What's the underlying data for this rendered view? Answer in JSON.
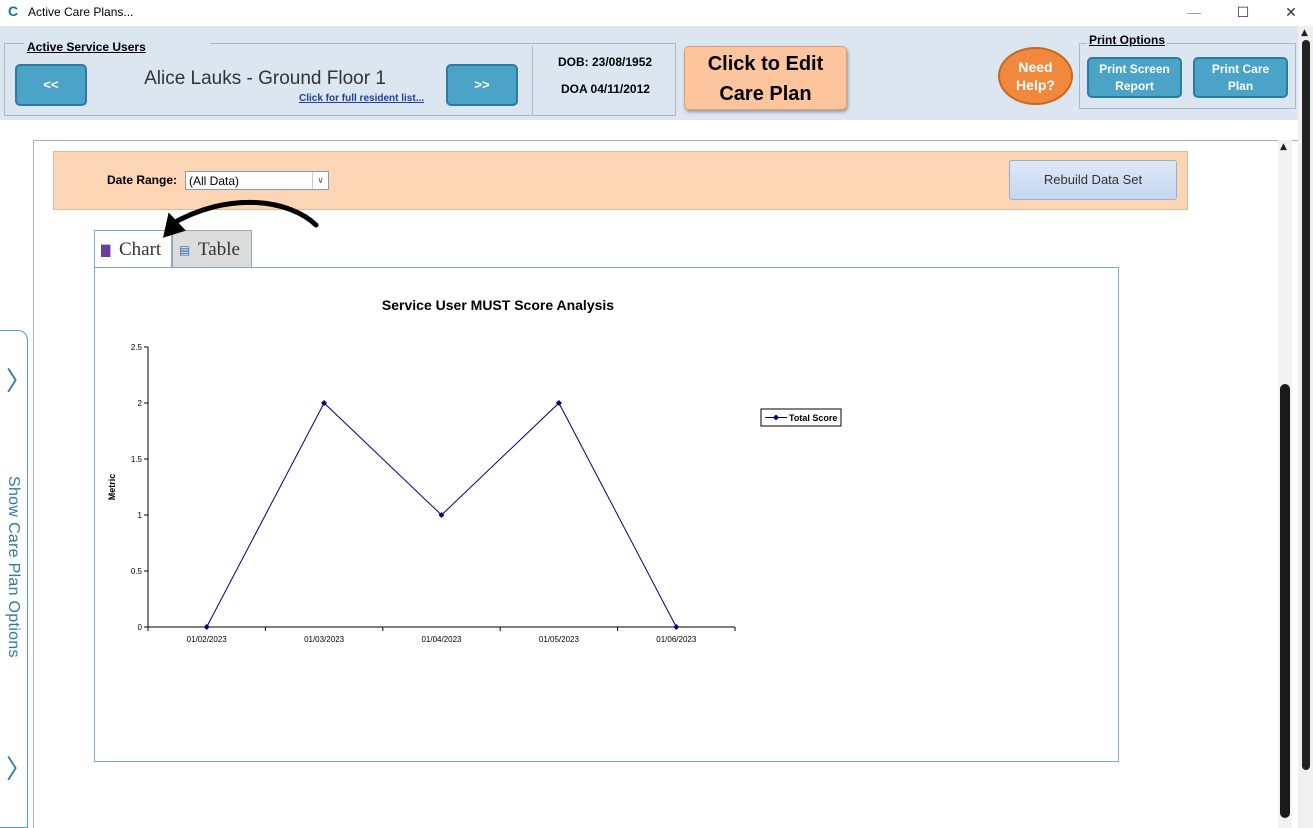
{
  "window": {
    "logo": "C",
    "title": "Active Care Plans...",
    "minimize_icon": "—",
    "maximize_icon": "☐",
    "close_icon": "✕"
  },
  "header": {
    "service_users_legend": "Active Service Users",
    "prev_label": "<<",
    "next_label": ">>",
    "resident_name": "Alice Lauks - Ground Floor 1",
    "resident_list_link": "Click for full resident list...",
    "dob": "DOB: 23/08/1952",
    "doa": "DOA 04/11/2012",
    "edit_line1": "Click to Edit",
    "edit_line2": "Care Plan",
    "help_line1": "Need",
    "help_line2": "Help?",
    "print_legend": "Print Options",
    "print_screen_line1": "Print Screen",
    "print_screen_line2": "Report",
    "print_care_line1": "Print Care",
    "print_care_line2": "Plan"
  },
  "side_panel": {
    "label": "Show Care Plan Options",
    "chevron": "〉"
  },
  "filter": {
    "date_range_label": "Date Range:",
    "date_range_value": "(All Data)",
    "dropdown_icon": "∨",
    "rebuild_label": "Rebuild Data Set"
  },
  "tabs": {
    "chart": "Chart",
    "table": "Table",
    "chart_icon": "▇",
    "table_icon": "▤"
  },
  "chart_data": {
    "type": "line",
    "title": "Service User MUST Score Analysis",
    "ylabel": "Metric",
    "xlabel": "",
    "categories": [
      "01/02/2023",
      "01/03/2023",
      "01/04/2023",
      "01/05/2023",
      "01/06/2023"
    ],
    "series": [
      {
        "name": "Total Score",
        "values": [
          0,
          2,
          1,
          2,
          0
        ],
        "color": "#000080"
      }
    ],
    "ylim": [
      0,
      2.5
    ],
    "yticks": [
      "0",
      "0.5",
      "1",
      "1.5",
      "2",
      "2.5"
    ],
    "ytick_values": [
      0,
      0.5,
      1,
      1.5,
      2,
      2.5
    ],
    "grid": false,
    "legend": "right"
  }
}
